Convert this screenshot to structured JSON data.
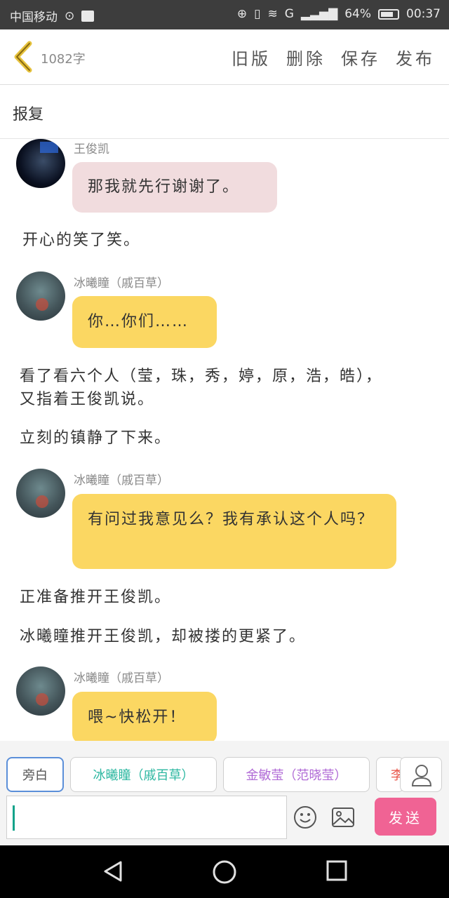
{
  "status_bar": {
    "carrier": "中国移动",
    "battery": "64%",
    "time": "00:37",
    "network": "G"
  },
  "toolbar": {
    "word_count": "1082字",
    "old_version": "旧版",
    "delete": "删除",
    "save": "保存",
    "publish": "发布"
  },
  "title": "报复",
  "messages": [
    {
      "speaker": "王俊凯",
      "text": "那我就先行谢谢了。"
    },
    {
      "narration": "开心的笑了笑。"
    },
    {
      "speaker": "冰曦瞳（戚百草）",
      "text": "你…你们……"
    },
    {
      "narration": "看了看六个人（莹，珠，秀，婷，原，浩，皓），又指着王俊凯说。"
    },
    {
      "narration": "立刻的镇静了下来。"
    },
    {
      "speaker": "冰曦瞳（戚百草）",
      "text": "有问过我意见么？我有承认这个人吗？"
    },
    {
      "narration": "正准备推开王俊凯。"
    },
    {
      "narration": "冰曦瞳推开王俊凯，却被搂的更紧了。"
    },
    {
      "speaker": "冰曦瞳（戚百草）",
      "text": "喂~快松开！"
    }
  ],
  "roles": [
    {
      "label": "旁白",
      "color": "#555555"
    },
    {
      "label": "冰曦瞳（戚百草）",
      "color": "#2bb7a0"
    },
    {
      "label": "金敏莹（范晓莹）",
      "color": "#b06ad6"
    },
    {
      "label": "李",
      "color": "#e8564a"
    }
  ],
  "send_label": "发送",
  "colors": {
    "bubble_pink": "#f1dcde",
    "bubble_yellow": "#fbd762",
    "send": "#f06394"
  }
}
